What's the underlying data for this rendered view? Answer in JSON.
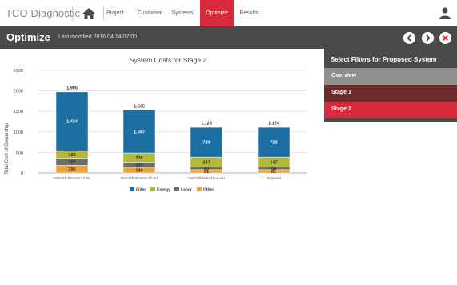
{
  "app": {
    "brand": "TCO Diagnostic"
  },
  "nav": {
    "tabs": [
      {
        "label": "Project"
      },
      {
        "label": "Customer"
      },
      {
        "label": "Systems"
      },
      {
        "label": "Optimize",
        "active": true
      },
      {
        "label": "Results"
      }
    ]
  },
  "subheader": {
    "title": "Optimize",
    "modified": "Last modified 2016 04 14 07:00"
  },
  "sidepanel": {
    "heading": "Select Filters for Proposed System",
    "items": [
      {
        "label": "Overview"
      },
      {
        "label": "Stage 1"
      },
      {
        "label": "Stage 2",
        "selected": true
      }
    ]
  },
  "colors": {
    "accent": "#d92a3b",
    "filter": "#1c6fa3",
    "energy": "#b4b83a",
    "labor": "#6d6d6d",
    "other": "#eda23a"
  },
  "chart_data": {
    "type": "bar",
    "stacked": true,
    "title": "System Costs for Stage 2",
    "ylabel": "Total Cost of Ownership",
    "ylim": [
      0,
      2500
    ],
    "yticks": [
      0,
      500,
      1000,
      1500,
      2000,
      2500
    ],
    "categories": [
      "VariCel® RF-M1S-12-SH",
      "VariCel® RF-M1S-12-SH",
      "VariCel® Pak-M1+-6-SH",
      "Proposed"
    ],
    "series": [
      {
        "name": "Other",
        "values": [
          190,
          139,
          81,
          81
        ],
        "color": "#eda23a"
      },
      {
        "name": "Labor",
        "values": [
          168,
          123,
          60,
          60
        ],
        "color": "#6d6d6d"
      },
      {
        "name": "Energy",
        "values": [
          183,
          225,
          247,
          247
        ],
        "color": "#b4b83a"
      },
      {
        "name": "Filter",
        "values": [
          1434,
          1047,
          723,
          723
        ],
        "color": "#1c6fa3"
      }
    ],
    "totals": [
      1985,
      1535,
      1124,
      1124
    ],
    "legend": [
      "Filter",
      "Energy",
      "Labor",
      "Other"
    ],
    "legend_position": "bottom"
  }
}
